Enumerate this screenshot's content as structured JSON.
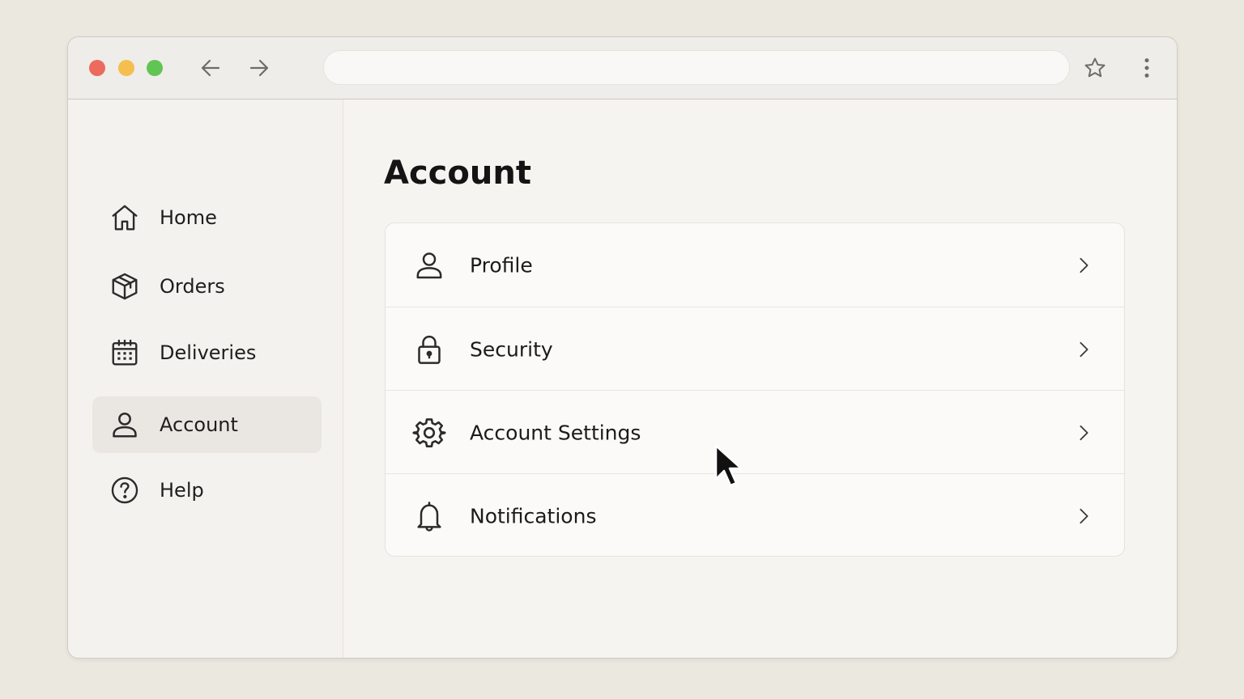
{
  "browser": {
    "address_value": "",
    "traffic_lights": {
      "close": "#ec6a5e",
      "minimize": "#f4bf4f",
      "maximize": "#61c554"
    },
    "icons": {
      "back": "arrow-left-icon",
      "forward": "arrow-right-icon",
      "bookmark": "star-icon",
      "menu": "more-vertical-icon"
    }
  },
  "sidebar": {
    "items": [
      {
        "label": "Home",
        "icon": "home-icon",
        "active": false
      },
      {
        "label": "Orders",
        "icon": "box-icon",
        "active": false
      },
      {
        "label": "Deliveries",
        "icon": "calendar-icon",
        "active": false
      },
      {
        "label": "Account",
        "icon": "user-icon",
        "active": true
      },
      {
        "label": "Help",
        "icon": "help-circle-icon",
        "active": false
      }
    ]
  },
  "main": {
    "title": "Account",
    "rows": [
      {
        "label": "Profile",
        "icon": "user-icon"
      },
      {
        "label": "Security",
        "icon": "lock-icon"
      },
      {
        "label": "Account Settings",
        "icon": "gear-icon"
      },
      {
        "label": "Notifications",
        "icon": "bell-icon"
      }
    ]
  },
  "colors": {
    "background": "#ebe8df",
    "window": "#f6f4f0",
    "active_item": "#eae7e2",
    "text": "#1b1b1b"
  }
}
